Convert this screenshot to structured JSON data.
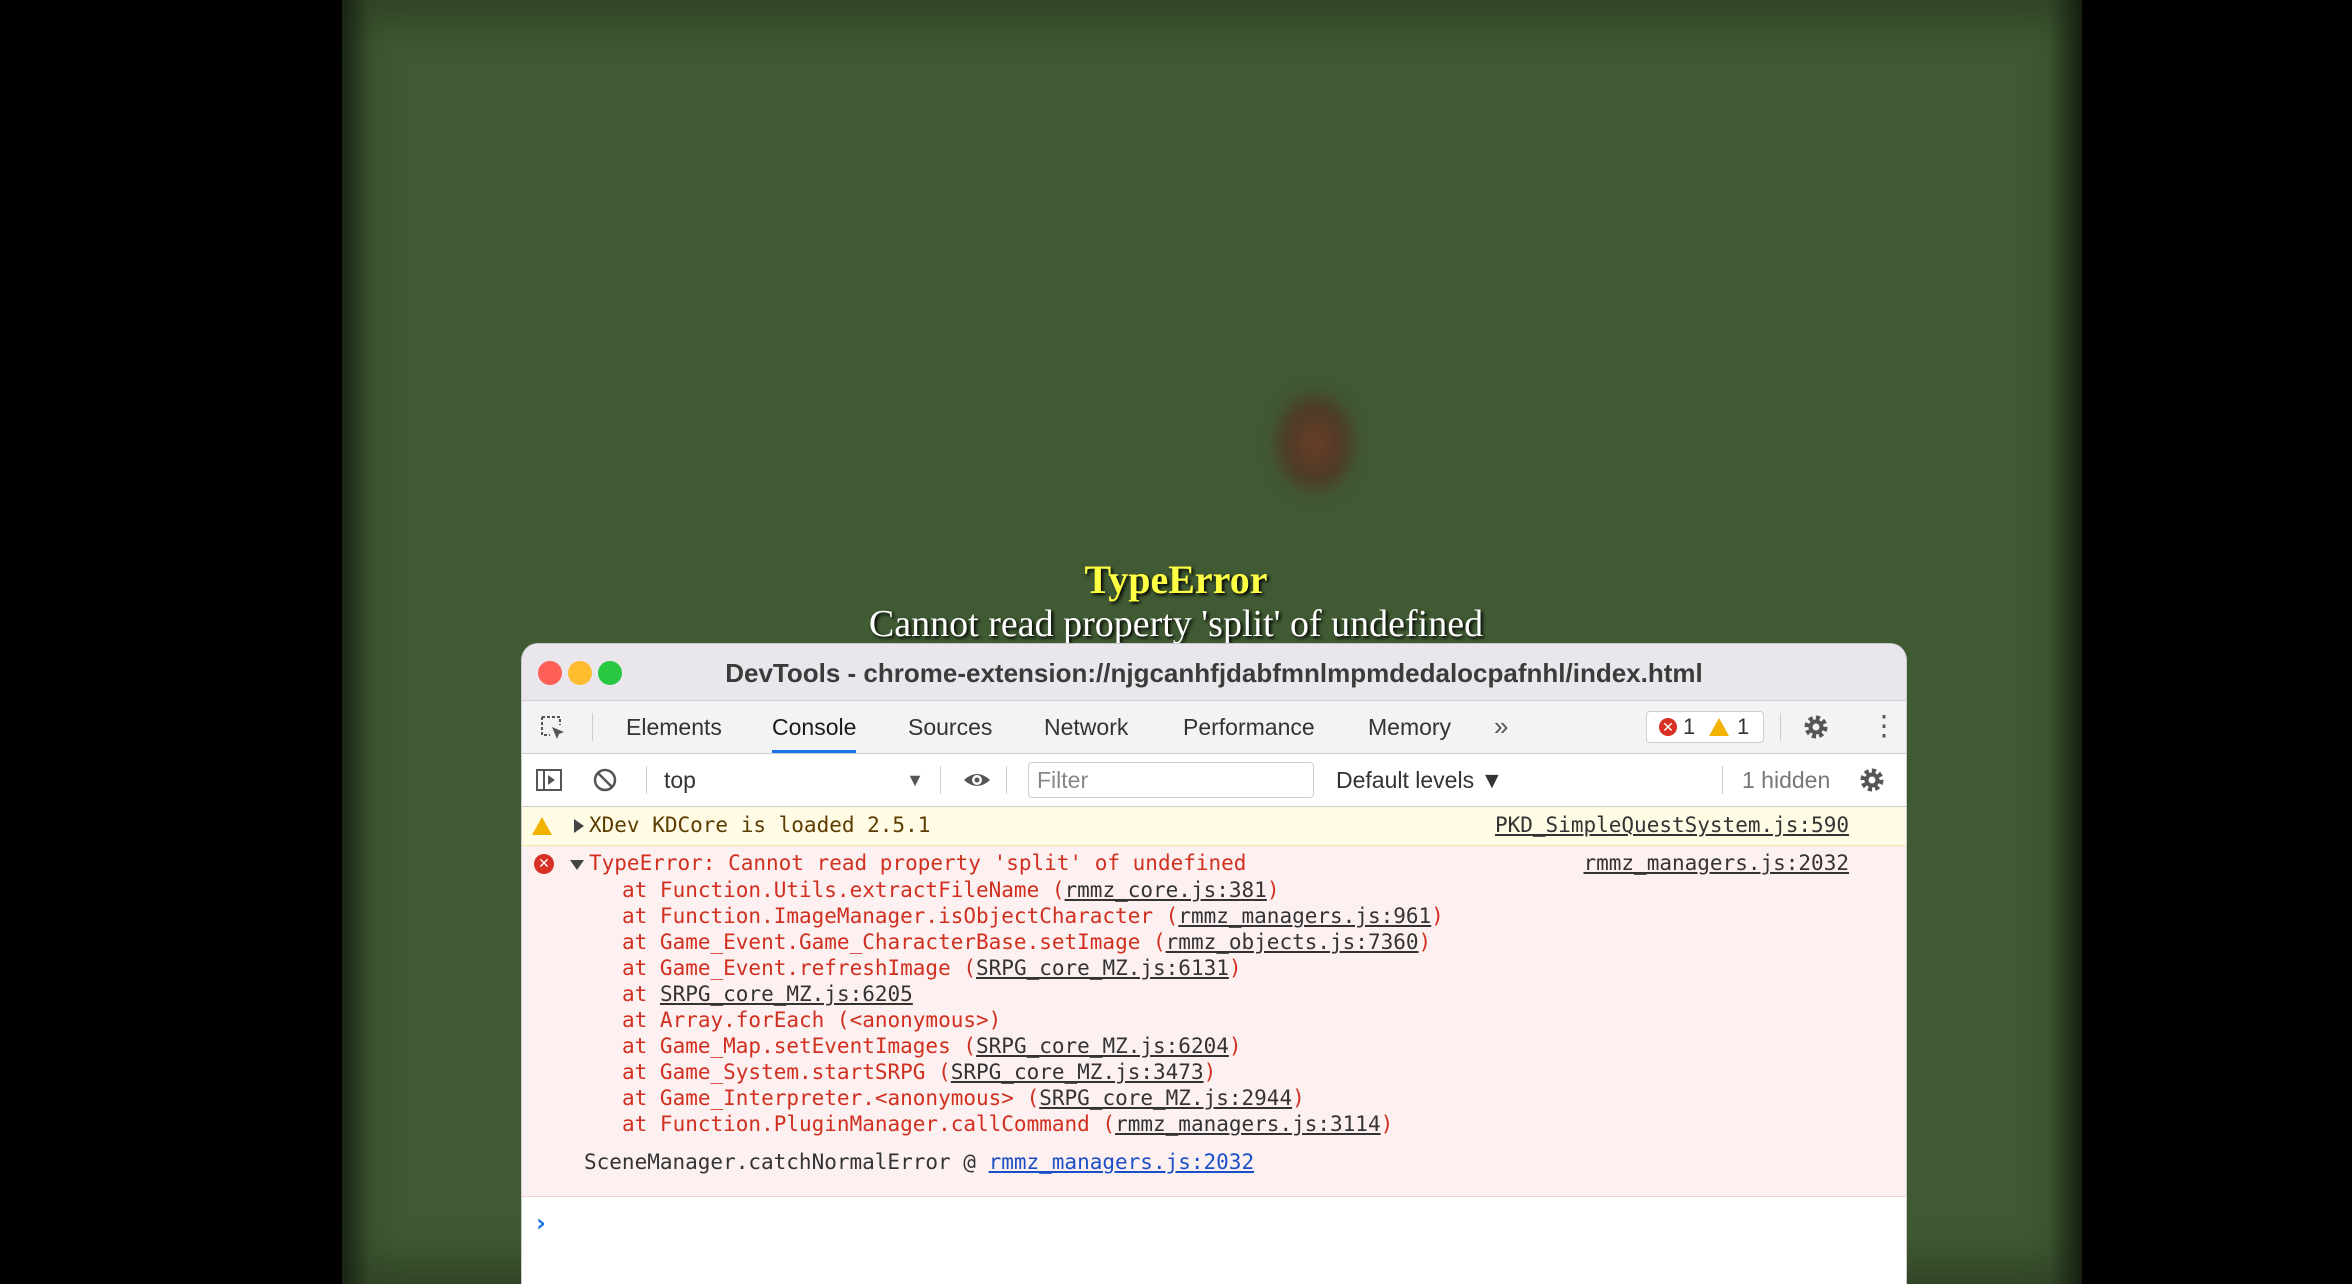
{
  "game": {
    "error_title": "TypeError",
    "error_message": "Cannot read property 'split' of undefined"
  },
  "devtools": {
    "window_title": "DevTools - chrome-extension://njgcanhfjdabfmnlmpmdedalocpafnhl/index.html",
    "tabs": [
      {
        "label": "Elements"
      },
      {
        "label": "Console"
      },
      {
        "label": "Sources"
      },
      {
        "label": "Network"
      },
      {
        "label": "Performance"
      },
      {
        "label": "Memory"
      }
    ],
    "more_tabs": "»",
    "error_count": "1",
    "warning_count": "1",
    "toolbar": {
      "context": "top",
      "filter_placeholder": "Filter",
      "levels": "Default levels ▼",
      "hidden": "1 hidden"
    },
    "warning": {
      "text": "XDev KDCore is loaded 2.5.1",
      "source": "PKD_SimpleQuestSystem.js:590"
    },
    "error": {
      "head": "TypeError: Cannot read property 'split' of undefined",
      "source": "rmmz_managers.js:2032",
      "stack": [
        {
          "pre": "at Function.Utils.extractFileName (",
          "link": "rmmz_core.js:381",
          "post": ")"
        },
        {
          "pre": "at Function.ImageManager.isObjectCharacter (",
          "link": "rmmz_managers.js:961",
          "post": ")"
        },
        {
          "pre": "at Game_Event.Game_CharacterBase.setImage (",
          "link": "rmmz_objects.js:7360",
          "post": ")"
        },
        {
          "pre": "at Game_Event.refreshImage (",
          "link": "SRPG_core_MZ.js:6131",
          "post": ")"
        },
        {
          "pre": "at ",
          "link": "SRPG_core_MZ.js:6205",
          "post": ""
        },
        {
          "pre": "at Array.forEach (<anonymous>)",
          "link": "",
          "post": ""
        },
        {
          "pre": "at Game_Map.setEventImages (",
          "link": "SRPG_core_MZ.js:6204",
          "post": ")"
        },
        {
          "pre": "at Game_System.startSRPG (",
          "link": "SRPG_core_MZ.js:3473",
          "post": ")"
        },
        {
          "pre": "at Game_Interpreter.<anonymous> (",
          "link": "SRPG_core_MZ.js:2944",
          "post": ")"
        },
        {
          "pre": "at Function.PluginManager.callCommand (",
          "link": "rmmz_managers.js:3114",
          "post": ")"
        }
      ],
      "catch_text": "SceneManager.catchNormalError @ ",
      "catch_link": "rmmz_managers.js:2032"
    },
    "prompt": "›"
  }
}
